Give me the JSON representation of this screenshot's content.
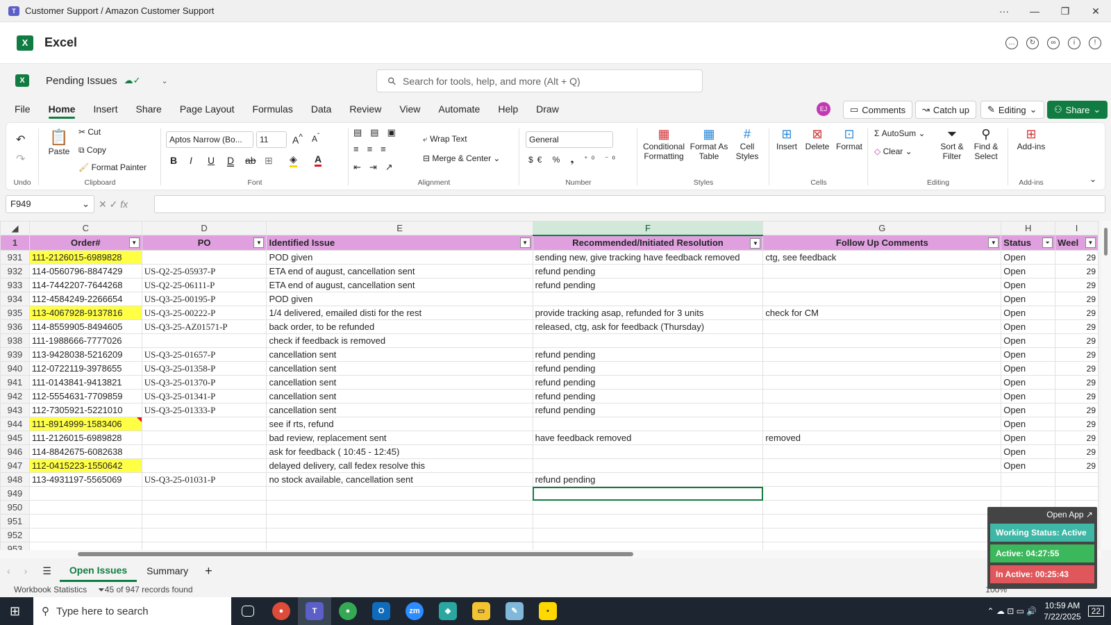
{
  "window": {
    "title": "Customer Support / Amazon Customer Support",
    "controls": [
      "···",
      "—",
      "❐",
      "✕"
    ]
  },
  "app": {
    "name": "Excel"
  },
  "doc": {
    "name": "Pending Issues"
  },
  "search": {
    "placeholder": "Search for tools, help, and more (Alt + Q)"
  },
  "menu": {
    "tabs": [
      "File",
      "Home",
      "Insert",
      "Share",
      "Page Layout",
      "Formulas",
      "Data",
      "Review",
      "View",
      "Automate",
      "Help",
      "Draw"
    ],
    "active": "Home"
  },
  "user": {
    "initials": "EJ"
  },
  "topright": {
    "comments": "Comments",
    "catchup": "Catch up",
    "editing": "Editing",
    "share": "Share"
  },
  "ribbon": {
    "undo_label": "Undo",
    "paste": "Paste",
    "cut": "Cut",
    "copy": "Copy",
    "format_painter": "Format Painter",
    "clipboard_label": "Clipboard",
    "font_name": "Aptos Narrow (Bo...",
    "font_size": "11",
    "font_label": "Font",
    "wrap": "Wrap Text",
    "merge": "Merge & Center",
    "alignment_label": "Alignment",
    "number_format": "General",
    "number_label": "Number",
    "cond_format": "Conditional Formatting",
    "format_table": "Format As Table",
    "cell_styles": "Cell Styles",
    "styles_label": "Styles",
    "insert": "Insert",
    "delete": "Delete",
    "format": "Format",
    "cells_label": "Cells",
    "autosum": "AutoSum",
    "clear": "Clear",
    "sort": "Sort & Filter",
    "find": "Find & Select",
    "editing_label": "Editing",
    "addins": "Add-ins",
    "addins_label": "Add-ins"
  },
  "formula": {
    "namebox": "F949",
    "value": ""
  },
  "columns": {
    "letters": [
      "C",
      "D",
      "E",
      "F",
      "G",
      "H",
      "I"
    ],
    "selected": "F"
  },
  "headers": {
    "row": "1",
    "cols": [
      "Order#",
      "PO",
      "Identified Issue",
      "Recommended/Initiated Resolution",
      "Follow Up Comments",
      "Status",
      "Weel"
    ]
  },
  "rows": [
    {
      "n": "931",
      "order": "111-2126015-6989828",
      "po": "",
      "issue": "POD given",
      "res": "sending new, give tracking have feedback removed",
      "follow": "ctg, see feedback",
      "status": "Open",
      "week": "29",
      "hl": true
    },
    {
      "n": "932",
      "order": "114-0560796-8847429",
      "po": "US-Q2-25-05937-P",
      "issue": "ETA end of august, cancellation sent",
      "res": "refund pending",
      "follow": "",
      "status": "Open",
      "week": "29"
    },
    {
      "n": "933",
      "order": "114-7442207-7644268",
      "po": "US-Q2-25-06111-P",
      "issue": "ETA end of august, cancellation sent",
      "res": "refund pending",
      "follow": "",
      "status": "Open",
      "week": "29"
    },
    {
      "n": "934",
      "order": "112-4584249-2266654",
      "po": "US-Q3-25-00195-P",
      "issue": "POD given",
      "res": "",
      "follow": "",
      "status": "Open",
      "week": "29"
    },
    {
      "n": "935",
      "order": "113-4067928-9137816",
      "po": "US-Q3-25-00222-P",
      "issue": "1/4 delivered, emailed disti for the rest",
      "res": "provide tracking asap, refunded for 3 units",
      "follow": "check for CM",
      "status": "Open",
      "week": "29",
      "hl": true
    },
    {
      "n": "936",
      "order": "114-8559905-8494605",
      "po": "US-Q3-25-AZ01571-P",
      "issue": "back order, to be refunded",
      "res": "released, ctg, ask for feedback (Thursday)",
      "follow": "",
      "status": "Open",
      "week": "29"
    },
    {
      "n": "938",
      "order": "111-1988666-7777026",
      "po": "",
      "issue": "check if feedback is removed",
      "res": "",
      "follow": "",
      "status": "Open",
      "week": "29"
    },
    {
      "n": "939",
      "order": "113-9428038-5216209",
      "po": "US-Q3-25-01657-P",
      "issue": "cancellation sent",
      "res": "refund pending",
      "follow": "",
      "status": "Open",
      "week": "29"
    },
    {
      "n": "940",
      "order": "112-0722119-3978655",
      "po": "US-Q3-25-01358-P",
      "issue": "cancellation sent",
      "res": "refund pending",
      "follow": "",
      "status": "Open",
      "week": "29"
    },
    {
      "n": "941",
      "order": "111-0143841-9413821",
      "po": "US-Q3-25-01370-P",
      "issue": "cancellation sent",
      "res": "refund pending",
      "follow": "",
      "status": "Open",
      "week": "29"
    },
    {
      "n": "942",
      "order": "112-5554631-7709859",
      "po": "US-Q3-25-01341-P",
      "issue": "cancellation sent",
      "res": "refund pending",
      "follow": "",
      "status": "Open",
      "week": "29"
    },
    {
      "n": "943",
      "order": "112-7305921-5221010",
      "po": "US-Q3-25-01333-P",
      "issue": "cancellation sent",
      "res": "refund pending",
      "follow": "",
      "status": "Open",
      "week": "29"
    },
    {
      "n": "944",
      "order": "111-8914999-1583406",
      "po": "",
      "issue": "see if rts, refund",
      "res": "",
      "follow": "",
      "status": "Open",
      "week": "29",
      "hl": true,
      "cm": true
    },
    {
      "n": "945",
      "order": "111-2126015-6989828",
      "po": "",
      "issue": "bad review, replacement sent",
      "res": "have feedback removed",
      "follow": "removed",
      "status": "Open",
      "week": "29"
    },
    {
      "n": "946",
      "order": "114-8842675-6082638",
      "po": "",
      "issue": "ask for feedback ( 10:45 - 12:45)",
      "res": "",
      "follow": "",
      "status": "Open",
      "week": "29"
    },
    {
      "n": "947",
      "order": "112-0415223-1550642",
      "po": "",
      "issue": "delayed delivery, call fedex resolve this",
      "res": "",
      "follow": "",
      "status": "Open",
      "week": "29",
      "hl": true
    },
    {
      "n": "948",
      "order": "113-4931197-5565069",
      "po": "US-Q3-25-01031-P",
      "issue": "no stock available, cancellation sent",
      "res": "refund pending",
      "follow": "",
      "status": "",
      "week": ""
    },
    {
      "n": "949",
      "order": "",
      "po": "",
      "issue": "",
      "res": "",
      "follow": "",
      "status": "",
      "week": "",
      "active": true
    },
    {
      "n": "950",
      "order": "",
      "po": "",
      "issue": "",
      "res": "",
      "follow": "",
      "status": "",
      "week": ""
    },
    {
      "n": "951",
      "order": "",
      "po": "",
      "issue": "",
      "res": "",
      "follow": "",
      "status": "",
      "week": ""
    },
    {
      "n": "952",
      "order": "",
      "po": "",
      "issue": "",
      "res": "",
      "follow": "",
      "status": "",
      "week": ""
    },
    {
      "n": "953",
      "order": "",
      "po": "",
      "issue": "",
      "res": "",
      "follow": "",
      "status": "",
      "week": ""
    }
  ],
  "sheets": [
    "Open Issues",
    "Summary"
  ],
  "status": {
    "stats": "Workbook Statistics",
    "records": "45 of 947 records found",
    "zoom": "100%"
  },
  "widget": {
    "open": "Open App ↗",
    "working": "Working Status: Active",
    "active": "Active: 04:27:55",
    "inactive": "In Active: 00:25:43"
  },
  "taskbar": {
    "search": "Type here to search",
    "time": "10:59 AM",
    "date": "7/22/2025",
    "notif": "22"
  },
  "colors": {
    "accent": "#107c41",
    "header_fill": "#e0a0e0",
    "highlight": "#ffff45",
    "active_green": "#3cb85c",
    "inactive_red": "#e0575b",
    "working_teal": "#3fb7a7"
  }
}
